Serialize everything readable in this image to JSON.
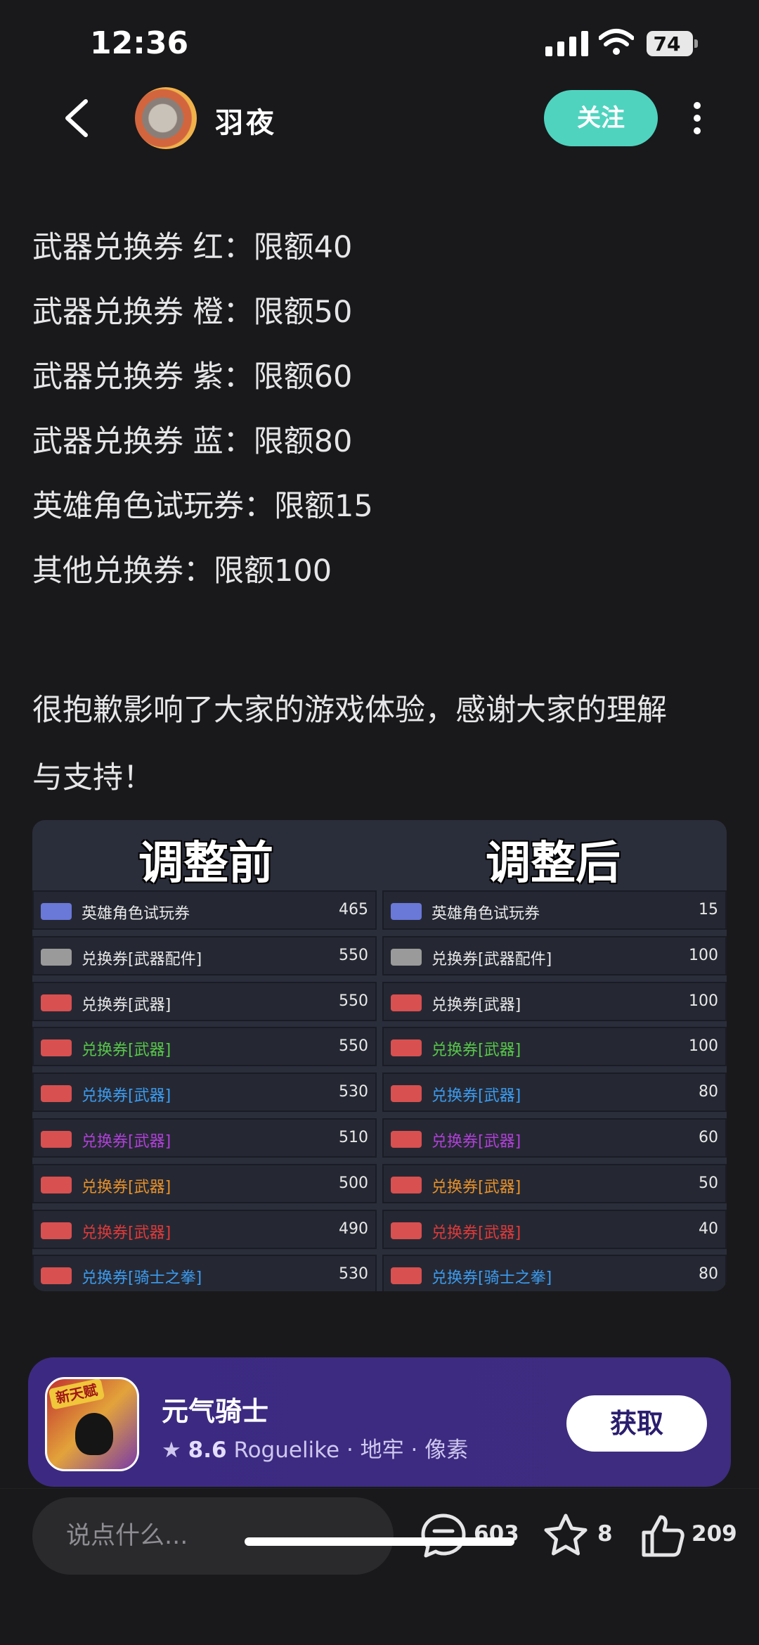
{
  "status": {
    "time": "12:36",
    "battery": "74"
  },
  "header": {
    "author": "羽夜",
    "follow_label": "关注"
  },
  "article": {
    "quotas": [
      "武器兑换券 红：限额40",
      "武器兑换券 橙：限额50",
      "武器兑换券 紫：限额60",
      "武器兑换券 蓝：限额80",
      "英雄角色试玩券：限额15",
      "其他兑换券：限额100"
    ],
    "closing_line1": "很抱歉影响了大家的游戏体验，感谢大家的理解",
    "closing_line2": "与支持！"
  },
  "comparison": {
    "before_title": "调整前",
    "after_title": "调整后",
    "rows": [
      {
        "name": "英雄角色试玩券",
        "color": "#e8e8e8",
        "ticket": "#6a78d8",
        "before": "465",
        "after": "15"
      },
      {
        "name": "兑换券[武器配件]",
        "color": "#e8e8e8",
        "ticket": "#9a9a9a",
        "before": "550",
        "after": "100"
      },
      {
        "name": "兑换券[武器]",
        "color": "#e8e8e8",
        "ticket": "#d85050",
        "before": "550",
        "after": "100"
      },
      {
        "name": "兑换券[武器]",
        "color": "#58c84a",
        "ticket": "#d85050",
        "before": "550",
        "after": "100"
      },
      {
        "name": "兑换券[武器]",
        "color": "#3c9cf0",
        "ticket": "#d85050",
        "before": "530",
        "after": "80"
      },
      {
        "name": "兑换券[武器]",
        "color": "#b040d8",
        "ticket": "#d85050",
        "before": "510",
        "after": "60"
      },
      {
        "name": "兑换券[武器]",
        "color": "#e8922a",
        "ticket": "#d85050",
        "before": "500",
        "after": "50"
      },
      {
        "name": "兑换券[武器]",
        "color": "#e03a3a",
        "ticket": "#d85050",
        "before": "490",
        "after": "40"
      },
      {
        "name": "兑换券[骑士之拳]",
        "color": "#3c9cf0",
        "ticket": "#d85050",
        "before": "530",
        "after": "80"
      }
    ]
  },
  "game_card": {
    "badge": "新天赋",
    "title": "元气骑士",
    "rating": "8.6",
    "tags": "Roguelike · 地牢 · 像素",
    "get_label": "获取"
  },
  "bottom_bar": {
    "placeholder": "说点什么...",
    "comments": "603",
    "favorites": "8",
    "likes": "209"
  }
}
